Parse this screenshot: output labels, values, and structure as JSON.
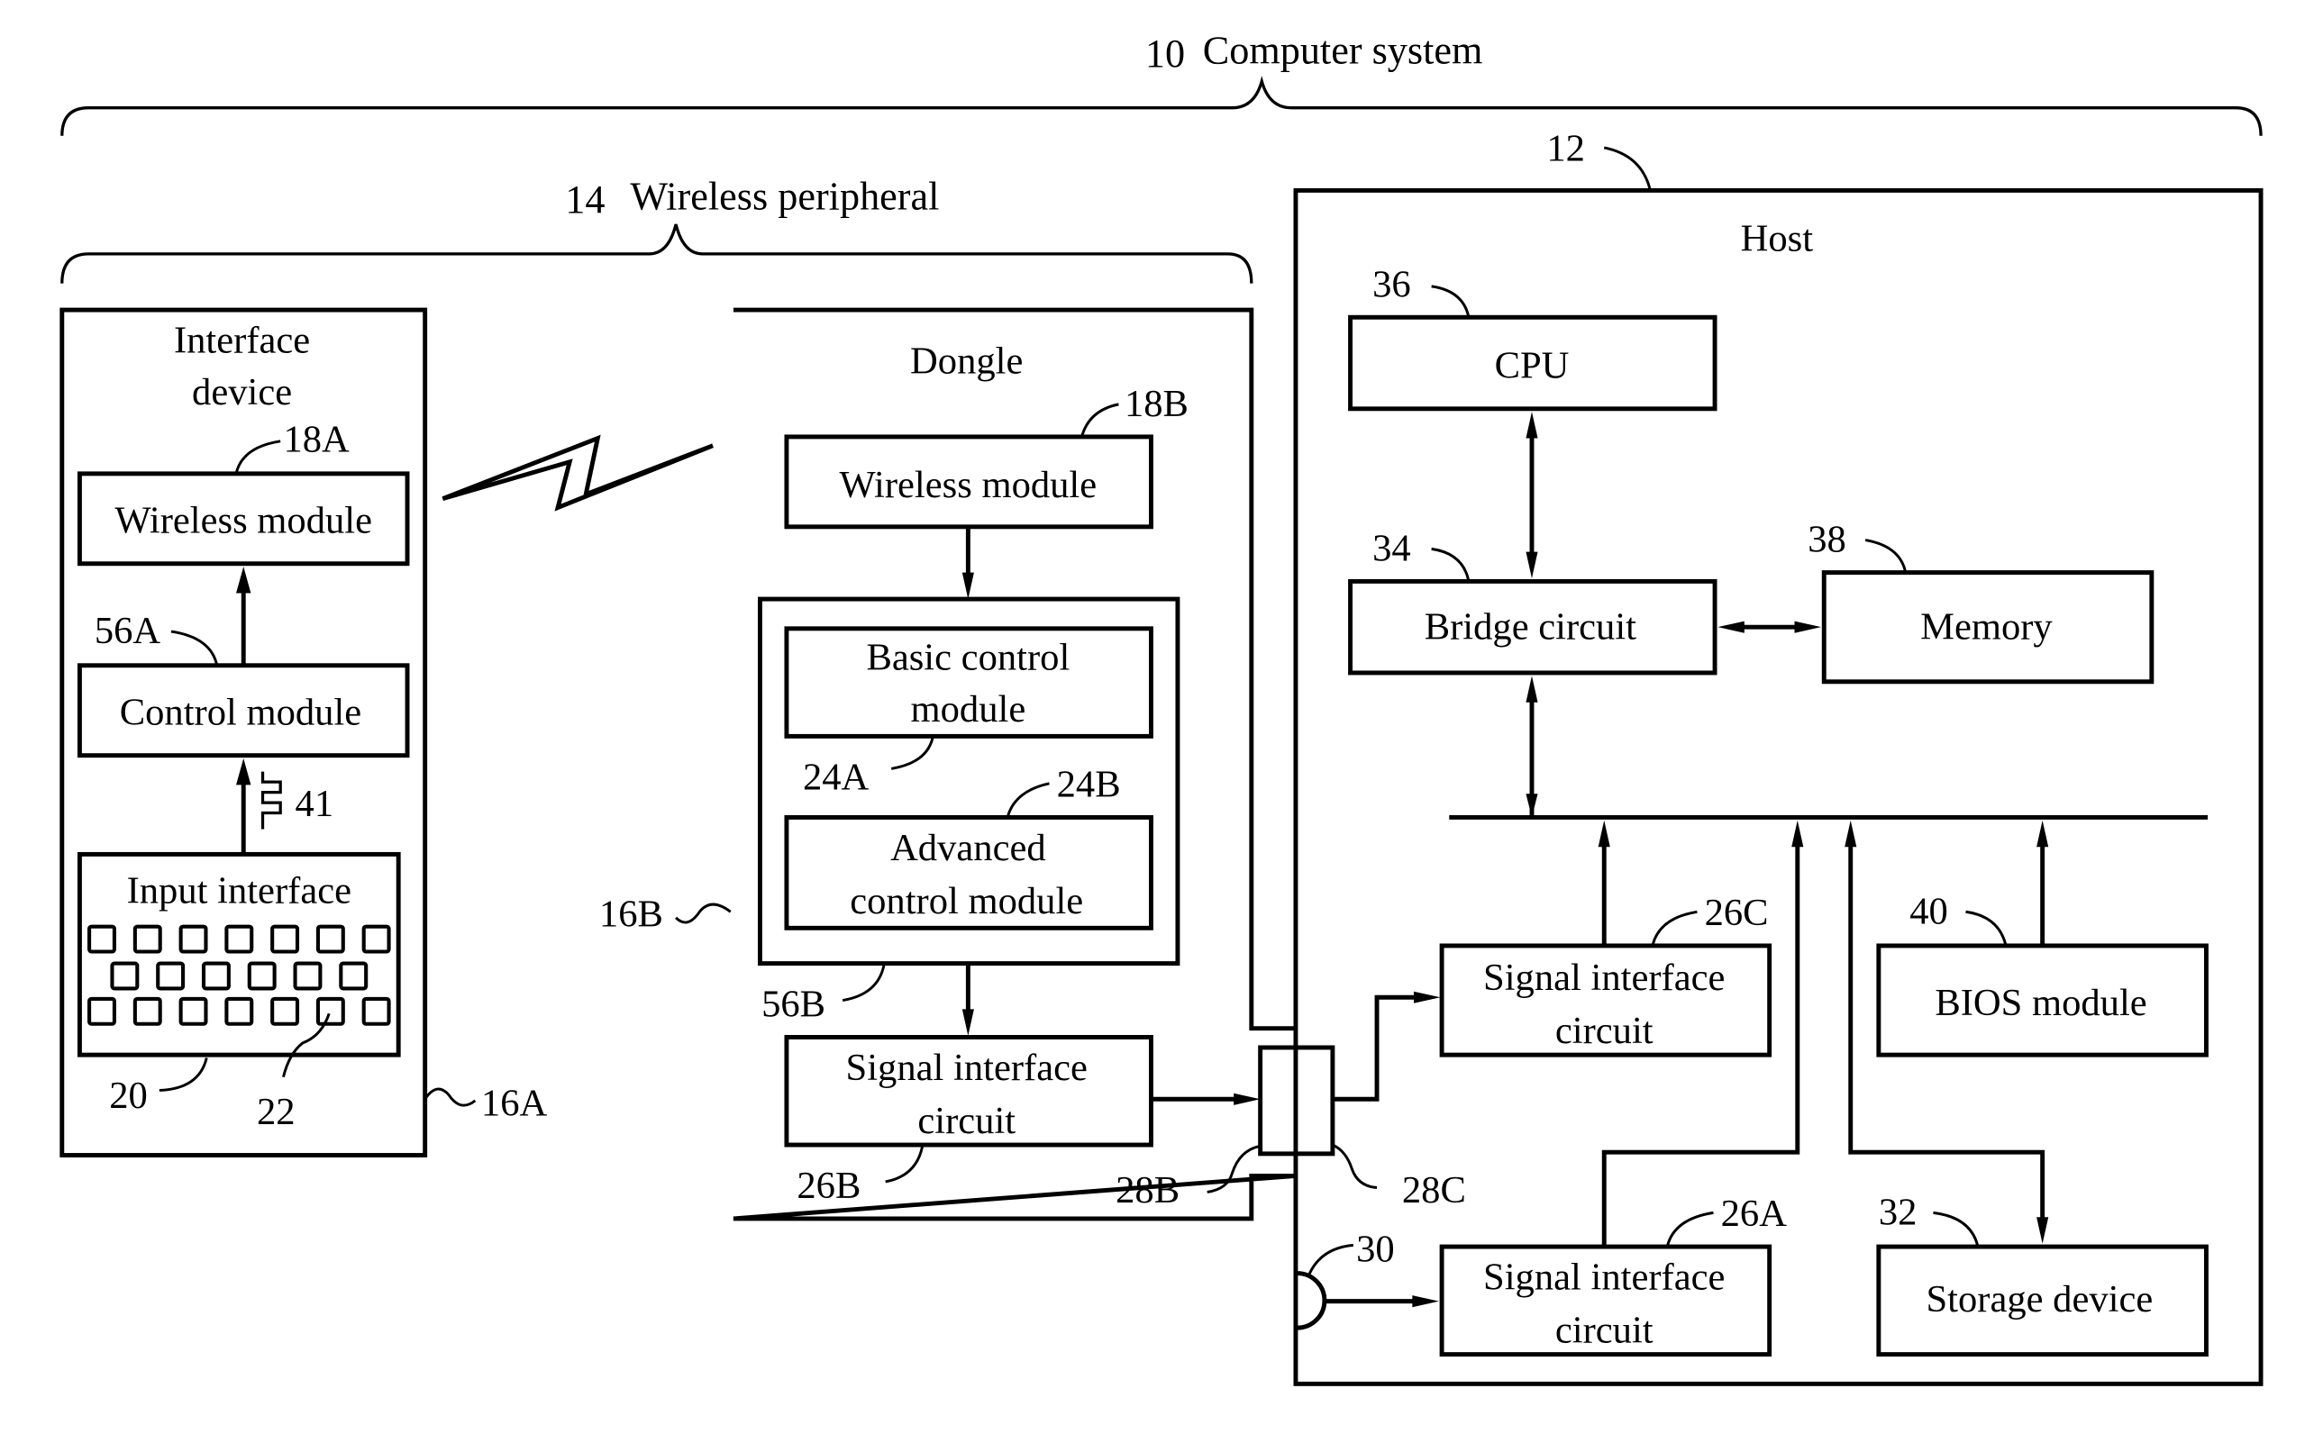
{
  "figure": {
    "system": {
      "ref": "10",
      "label": "Computer system"
    },
    "peripheral": {
      "ref": "14",
      "label": "Wireless peripheral"
    },
    "interface_device": {
      "ref": "16A",
      "title_line1": "Interface",
      "title_line2": "device",
      "wireless_module": {
        "ref": "18A",
        "label": "Wireless module"
      },
      "control_module": {
        "ref": "56A",
        "label": "Control module"
      },
      "signal_ref": "41",
      "input_interface": {
        "ref": "20",
        "label": "Input interface",
        "key_ref": "22"
      },
      "keyboard_rows": [
        7,
        6,
        7
      ]
    },
    "dongle": {
      "ref": "16B",
      "title": "Dongle",
      "wireless_module": {
        "ref": "18B",
        "label": "Wireless module"
      },
      "control_group_ref": "56B",
      "basic_control": {
        "ref": "24A",
        "line1": "Basic control",
        "line2": "module"
      },
      "advanced_control": {
        "ref": "24B",
        "line1": "Advanced",
        "line2": "control module"
      },
      "signal_interface": {
        "ref": "26B",
        "line1": "Signal interface",
        "line2": "circuit"
      },
      "connector_ref": "28B"
    },
    "host": {
      "ref": "12",
      "title": "Host",
      "connector_ref": "28C",
      "port_ref": "30",
      "cpu": {
        "ref": "36",
        "label": "CPU"
      },
      "bridge": {
        "ref": "34",
        "label": "Bridge circuit"
      },
      "memory": {
        "ref": "38",
        "label": "Memory"
      },
      "signal_interface_c": {
        "ref": "26C",
        "line1": "Signal interface",
        "line2": "circuit"
      },
      "bios": {
        "ref": "40",
        "label": "BIOS module"
      },
      "signal_interface_a": {
        "ref": "26A",
        "line1": "Signal interface",
        "line2": "circuit"
      },
      "storage": {
        "ref": "32",
        "label": "Storage device"
      }
    }
  }
}
